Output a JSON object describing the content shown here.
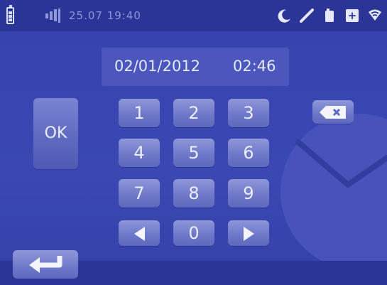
{
  "status_bar": {
    "datetime": "25.07 19:40",
    "icons": [
      "battery-icon",
      "signal-icon",
      "moon-icon",
      "pen-icon",
      "doorbell-icon",
      "plus-icon",
      "wifi-icon"
    ]
  },
  "display": {
    "date": "02/01/2012",
    "time": "02:46"
  },
  "keypad": {
    "ok_label": "OK",
    "keys": [
      "1",
      "2",
      "3",
      "4",
      "5",
      "6",
      "7",
      "8",
      "9"
    ],
    "zero": "0",
    "left_icon": "arrow-left-icon",
    "right_icon": "arrow-right-icon"
  },
  "controls": {
    "backspace_icon": "backspace-icon",
    "return_icon": "return-icon"
  },
  "colors": {
    "background": "#3642ad",
    "bar": "#2a3597",
    "key": "#7a84d2",
    "text": "#e6e8fb"
  }
}
